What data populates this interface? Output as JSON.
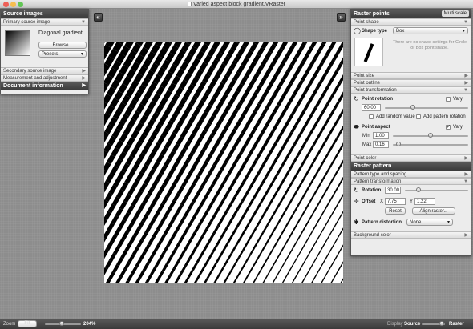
{
  "window": {
    "title": "Varied aspect block gradient.VRaster"
  },
  "left_panel": {
    "title": "Source images",
    "primary_section": "Primary source image",
    "source_name": "Diagonal gradient",
    "browse_label": "Browse...",
    "presets_label": "Presets",
    "secondary_section": "Secondary source image",
    "measurement_section": "Measurement and adjustment",
    "document_section": "Document information"
  },
  "right_panel": {
    "title": "Raster points",
    "multi_scale_label": "Multi scale",
    "point_shape_section": "Point shape",
    "shape_type_label": "Shape type",
    "shape_type_value": "Box",
    "no_shape_note": "There are no shape settings for Circle or Box point shape.",
    "point_size_section": "Point size",
    "point_outline_section": "Point outline",
    "point_transformation_section": "Point transformation",
    "point_rotation_label": "Point rotation",
    "vary_label": "Vary",
    "rotation_value": "60.00",
    "add_random_label": "Add random value",
    "add_pattern_rotation_label": "Add pattern rotation",
    "point_aspect_label": "Point aspect",
    "vary_aspect_label": "Vary",
    "min_label": "Min",
    "min_value": "1.00",
    "max_label": "Max",
    "max_value": "0.16",
    "point_color_section": "Point color",
    "raster_pattern_title": "Raster pattern",
    "pattern_type_section": "Pattern type and spacing",
    "pattern_transformation_section": "Pattern transformation",
    "rotation_label": "Rotation",
    "pattern_rotation_value": "30.00",
    "offset_label": "Offset",
    "x_label": "X",
    "offset_x": "7.75",
    "y_label": "Y",
    "offset_y": "1.22",
    "reset_label": "Reset",
    "align_raster_label": "Align raster...",
    "pattern_distortion_label": "Pattern distortion",
    "distortion_value": "None",
    "background_color_section": "Background color"
  },
  "status": {
    "zoom_label": "Zoom",
    "fit_label": "Fit",
    "zoom_percent": "204%",
    "display_label": "Display",
    "source_label": "Source",
    "raster_label": "Raster"
  },
  "colors": {
    "panel_header": "#3a3a3a",
    "workspace": "#8d8d8d",
    "accent_blue": "#3b7bd6"
  }
}
